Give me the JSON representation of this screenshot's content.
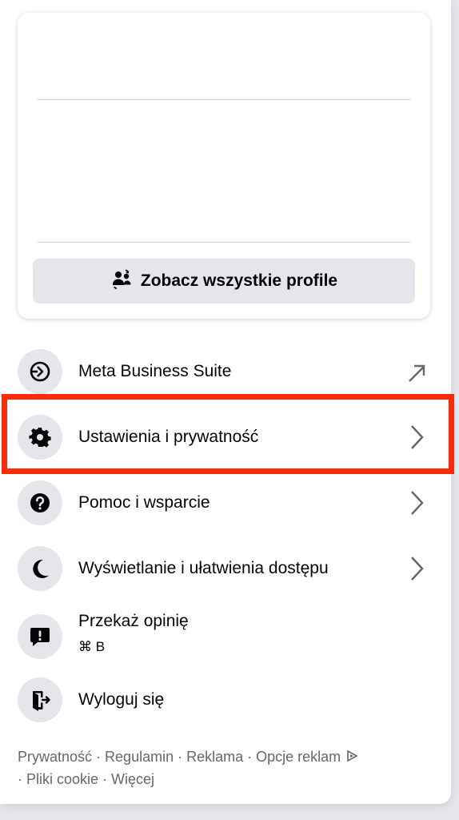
{
  "profiles": {
    "see_all_label": "Zobacz wszystkie profile"
  },
  "menu": {
    "items": [
      {
        "label": "Meta Business Suite",
        "icon": "meta-business-suite-icon",
        "trailing": "external-arrow-icon"
      },
      {
        "label": "Ustawienia i prywatność",
        "icon": "gear-icon",
        "trailing": "chevron-right-icon"
      },
      {
        "label": "Pomoc i wsparcie",
        "icon": "question-icon",
        "trailing": "chevron-right-icon"
      },
      {
        "label": "Wyświetlanie i ułatwienia dostępu",
        "icon": "moon-icon",
        "trailing": "chevron-right-icon"
      },
      {
        "label": "Przekaż opinię",
        "shortcut": "⌘ B",
        "icon": "feedback-icon"
      },
      {
        "label": "Wyloguj się",
        "icon": "logout-icon"
      }
    ]
  },
  "footer": {
    "links": [
      "Prywatność",
      "Regulamin",
      "Reklama",
      "Opcje reklam",
      "Pliki cookie",
      "Więcej"
    ],
    "separator": " · "
  },
  "colors": {
    "highlight": "#ff2a0a",
    "icon_bg": "#e4e6eb",
    "footer_text": "#65676b"
  }
}
